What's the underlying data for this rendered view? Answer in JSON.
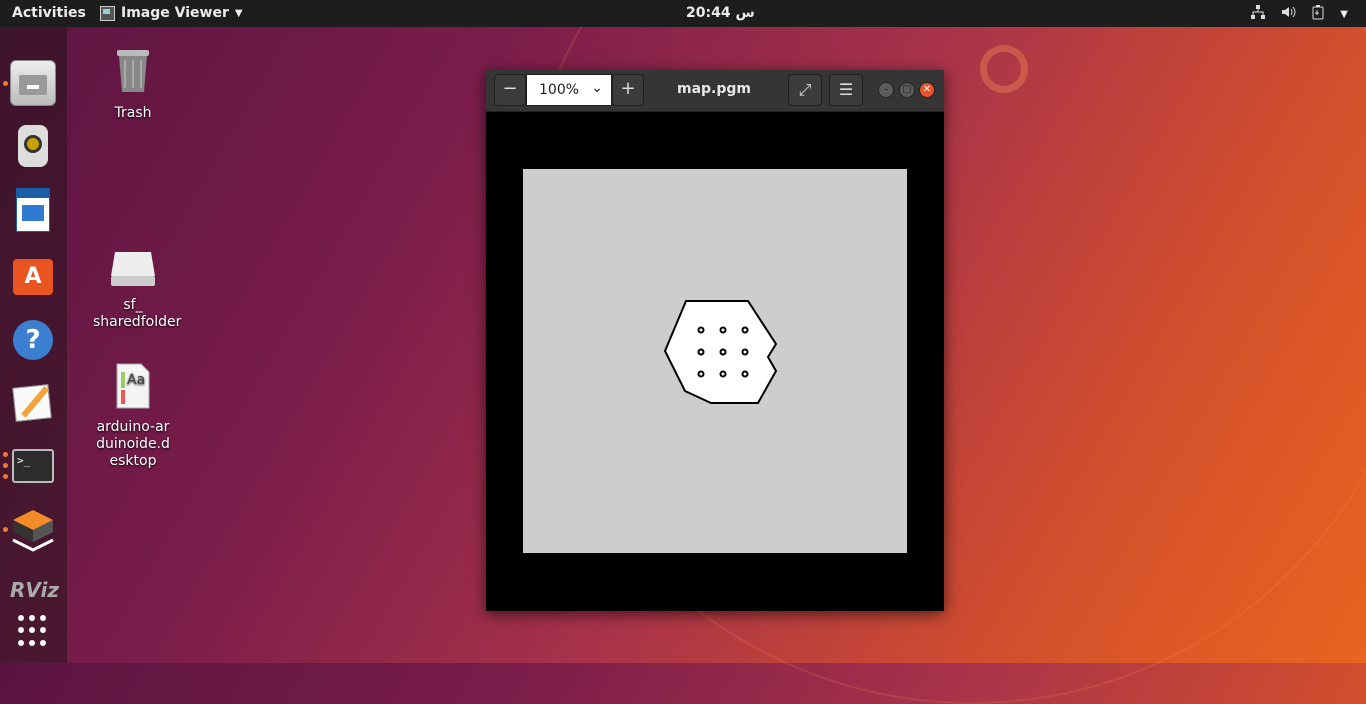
{
  "topbar": {
    "activities": "Activities",
    "app_name": "Image Viewer",
    "clock": "س 20:44"
  },
  "dock": {
    "items": [
      "files",
      "rhythmbox",
      "libreoffice-writer",
      "software-center",
      "help",
      "text-editor",
      "terminal",
      "virtualbox",
      "rviz"
    ],
    "rviz_label": "RViz"
  },
  "desktop": {
    "icons": [
      {
        "label": "Trash"
      },
      {
        "label": "sf_ sharedfolder"
      },
      {
        "label": "arduino-arduinoide.desktop"
      }
    ]
  },
  "window": {
    "title": "map.pgm",
    "zoom_value": "100%",
    "colors": {
      "header": "#353535",
      "map_unknown": "#cdcdcd",
      "map_free": "#ffffff",
      "map_occupied": "#000000",
      "close": "#e7542a"
    }
  }
}
